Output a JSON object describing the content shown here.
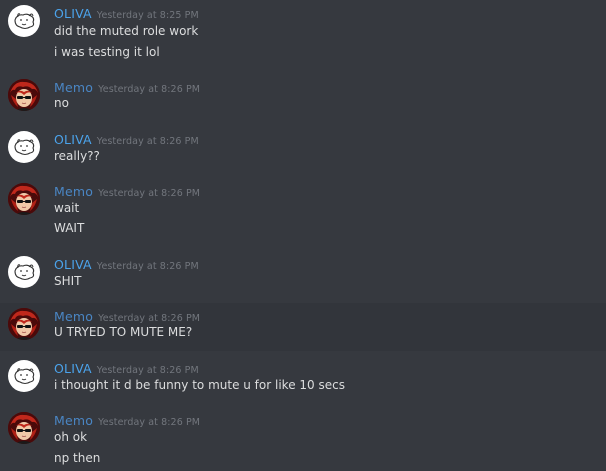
{
  "colors": {
    "background": "#36393f",
    "hover_background": "#32353b",
    "username_oliva": "#4ba3eb",
    "username_memo": "#4a86c4",
    "timestamp": "#72767d",
    "message_text": "#dcddde"
  },
  "messages": [
    {
      "author": "OLIVA",
      "avatar_icon": "dog-sketch-avatar-icon",
      "timestamp": "Yesterday at 8:25 PM",
      "lines": [
        "did the muted role work",
        "i was testing it lol"
      ]
    },
    {
      "author": "Memo",
      "avatar_icon": "red-anime-avatar-icon",
      "timestamp": "Yesterday at 8:26 PM",
      "lines": [
        "no"
      ]
    },
    {
      "author": "OLIVA",
      "avatar_icon": "dog-sketch-avatar-icon",
      "timestamp": "Yesterday at 8:26 PM",
      "lines": [
        "really??"
      ]
    },
    {
      "author": "Memo",
      "avatar_icon": "red-anime-avatar-icon",
      "timestamp": "Yesterday at 8:26 PM",
      "lines": [
        "wait",
        "WAIT"
      ]
    },
    {
      "author": "OLIVA",
      "avatar_icon": "dog-sketch-avatar-icon",
      "timestamp": "Yesterday at 8:26 PM",
      "lines": [
        "SHIT"
      ]
    },
    {
      "author": "Memo",
      "avatar_icon": "red-anime-avatar-icon",
      "timestamp": "Yesterday at 8:26 PM",
      "lines": [
        "U TRYED TO MUTE ME?"
      ]
    },
    {
      "author": "OLIVA",
      "avatar_icon": "dog-sketch-avatar-icon",
      "timestamp": "Yesterday at 8:26 PM",
      "lines": [
        "i thought it d be funny to mute u for like 10 secs"
      ]
    },
    {
      "author": "Memo",
      "avatar_icon": "red-anime-avatar-icon",
      "timestamp": "Yesterday at 8:26 PM",
      "lines": [
        "oh ok",
        "np then"
      ]
    }
  ]
}
